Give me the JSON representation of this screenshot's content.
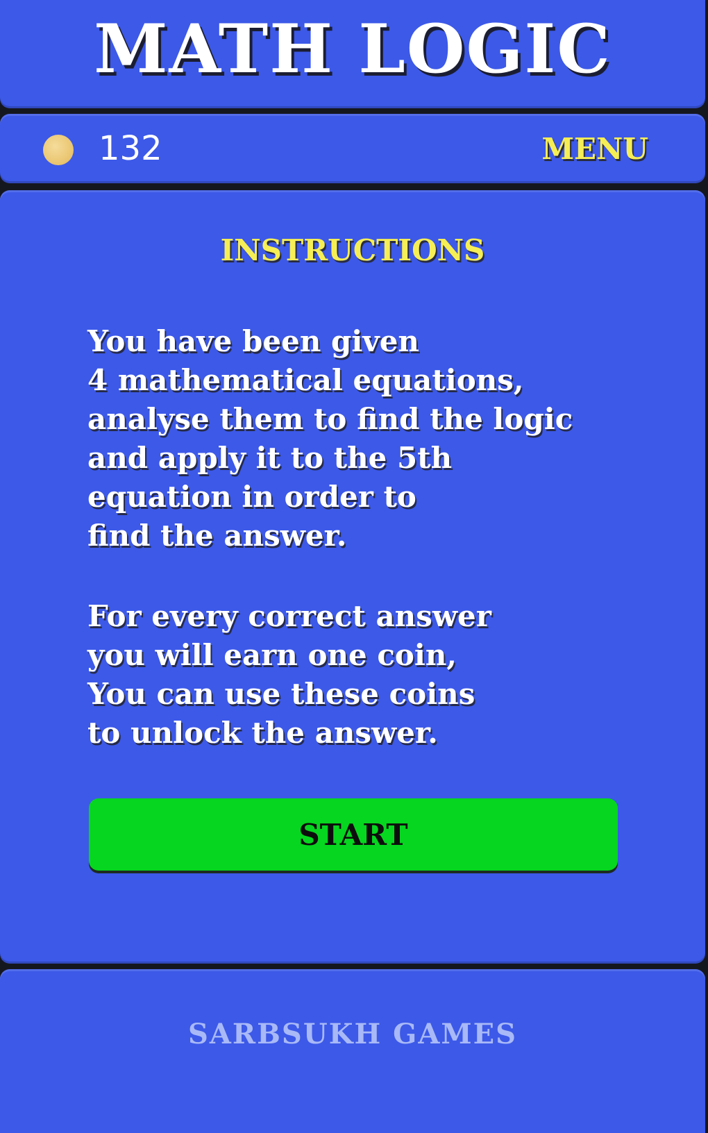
{
  "app": {
    "title": "MATH LOGIC"
  },
  "topbar": {
    "coin_count": "132",
    "menu_label": "MENU",
    "coin_icon": "coin-icon"
  },
  "instructions": {
    "heading": "INSTRUCTIONS",
    "paragraph1": [
      "You have been given",
      "4 mathematical equations,",
      "analyse them to find the logic",
      "and apply it to the 5th",
      "equation in order to",
      "find the answer."
    ],
    "paragraph2": [
      "For every correct answer",
      "you will earn one coin,",
      "You can use these coins",
      "to unlock the answer."
    ],
    "start_label": "START"
  },
  "footer": {
    "brand": "SARBSUKH GAMES"
  },
  "colors": {
    "panel": "#3c59e8",
    "background": "#15171f",
    "accent_yellow": "#f6ee55",
    "start_green": "#06d61f",
    "coin": "#e9c46e",
    "brand_text": "#a9b9f7"
  }
}
